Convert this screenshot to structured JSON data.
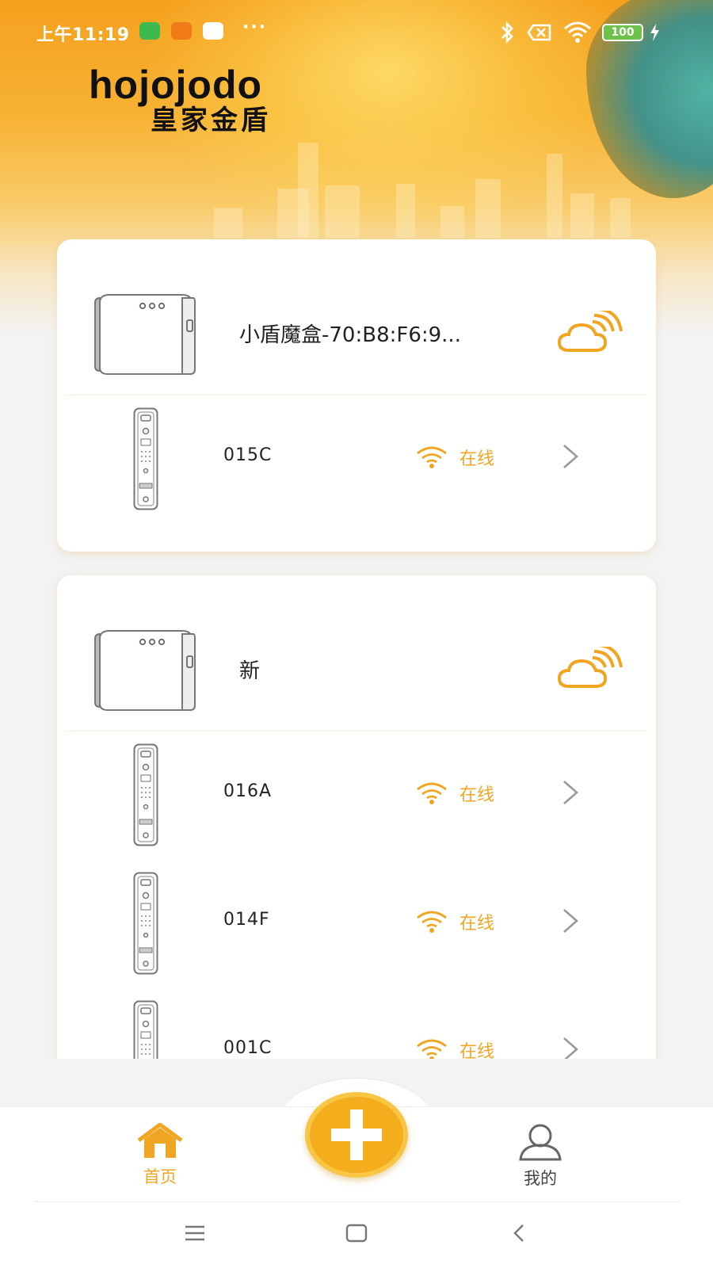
{
  "status_bar": {
    "time": "上午11:19",
    "more": "···",
    "battery": "100"
  },
  "logo": {
    "en": "hojojodo",
    "cn": "皇家金盾"
  },
  "groups": [
    {
      "hub_name": "小盾魔盒-70:B8:F6:9...",
      "locks": [
        {
          "name": "015C",
          "status": "在线"
        }
      ]
    },
    {
      "hub_name": "新",
      "locks": [
        {
          "name": "016A",
          "status": "在线"
        },
        {
          "name": "014F",
          "status": "在线"
        },
        {
          "name": "001C",
          "status": "在线"
        }
      ]
    }
  ],
  "nav": {
    "home": "首页",
    "mine": "我的"
  },
  "colors": {
    "accent": "#f0a623",
    "header_orange": "#f5a01e"
  }
}
